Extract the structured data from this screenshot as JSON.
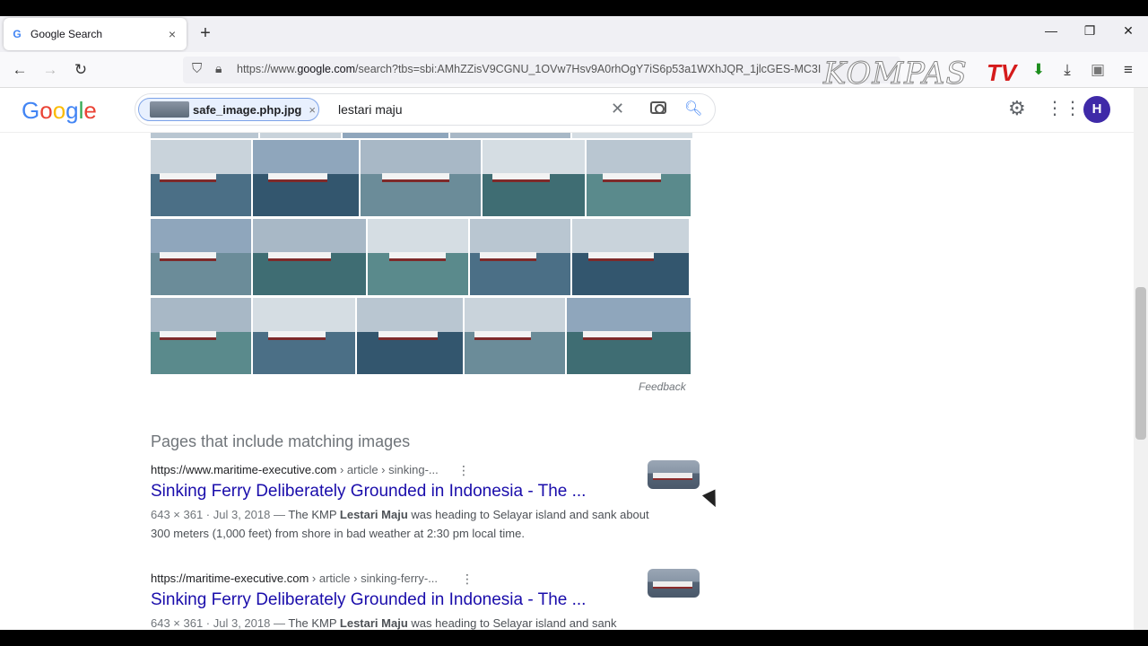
{
  "browser": {
    "tab_title": "Google Search",
    "tab_close": "×",
    "new_tab": "+",
    "url_prefix": "https://www.",
    "url_domain": "google.com",
    "url_rest": "/search?tbs=sbi:AMhZZisV9CGNU_1OVw7Hsv9A0rhOgY7iS6p53a1WXhJQR_1jlcGES-MC3I",
    "watermark": "KOMPAS",
    "watermark_tv": "TV",
    "win_min": "—",
    "win_restore": "❐",
    "win_close": "✕"
  },
  "google": {
    "logo": [
      "G",
      "o",
      "o",
      "g",
      "l",
      "e"
    ],
    "logo_colors": [
      "#4285f4",
      "#ea4335",
      "#fbbc05",
      "#4285f4",
      "#34a853",
      "#ea4335"
    ],
    "chip_label": "safe_image.php.jpg",
    "chip_remove": "×",
    "query": "lestari maju",
    "clear": "✕",
    "avatar_initial": "H"
  },
  "image_grid": {
    "feedback": "Feedback"
  },
  "section": {
    "title": "Pages that include matching images"
  },
  "results": [
    {
      "url_host": "https://www.maritime-executive.com",
      "url_path": " › article › sinking-...",
      "title": "Sinking Ferry Deliberately Grounded in Indonesia - The ...",
      "meta": "643 × 361 · Jul 3, 2018 —",
      "desc_pre": " The KMP ",
      "desc_bold": "Lestari Maju",
      "desc_post": " was heading to Selayar island and sank about 300 meters (1,000 feet) from shore in bad weather at 2:30 pm local time."
    },
    {
      "url_host": "https://maritime-executive.com",
      "url_path": " › article › sinking-ferry-...",
      "title": "Sinking Ferry Deliberately Grounded in Indonesia - The ...",
      "meta": "643 × 361 · Jul 3, 2018 —",
      "desc_pre": " The KMP ",
      "desc_bold": "Lestari Maju",
      "desc_post": " was heading to Selayar island and sank"
    }
  ]
}
